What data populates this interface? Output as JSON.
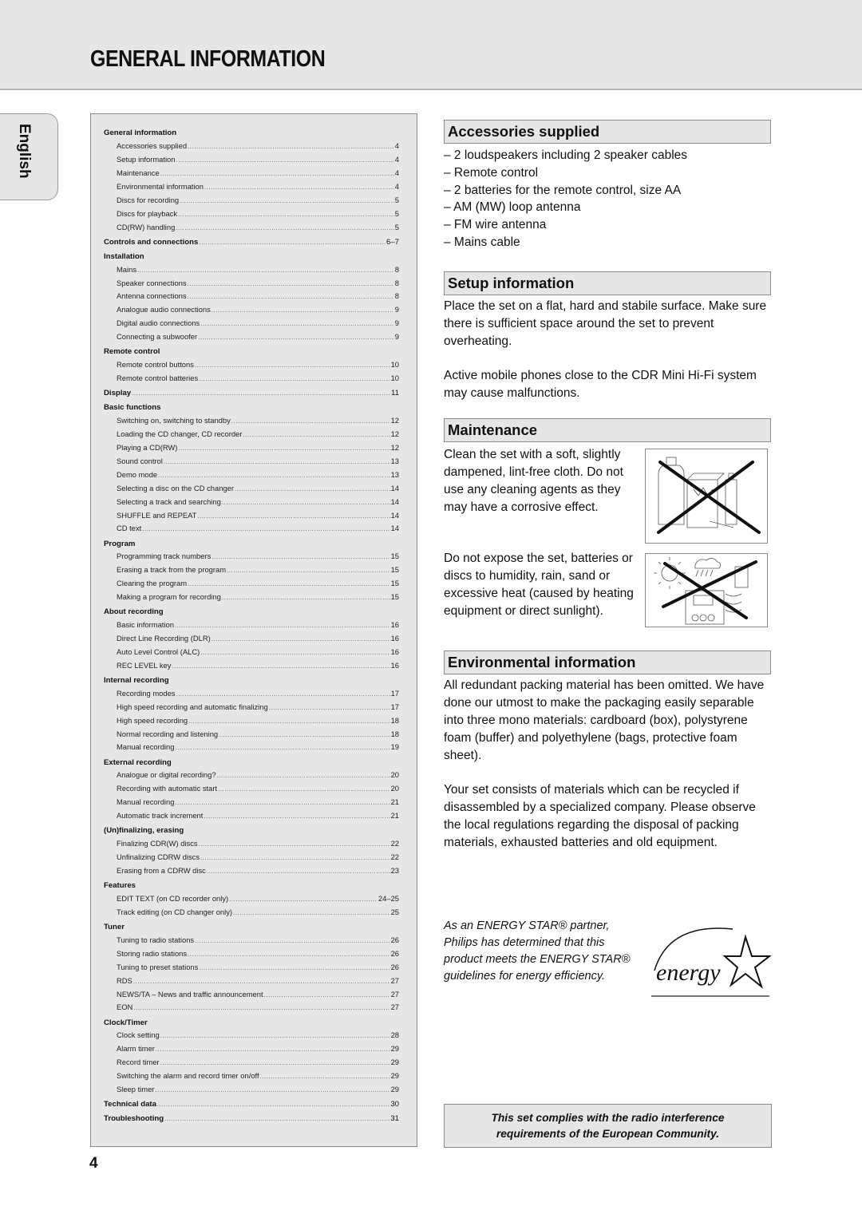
{
  "header": {
    "title": "GENERAL INFORMATION"
  },
  "language_tab": "English",
  "toc": [
    {
      "title": "General information",
      "page": "",
      "items": [
        {
          "label": "Accessories supplied",
          "page": "4"
        },
        {
          "label": "Setup information",
          "page": "4"
        },
        {
          "label": "Maintenance",
          "page": "4"
        },
        {
          "label": "Environmental information",
          "page": "4"
        },
        {
          "label": "Discs for recording",
          "page": "5"
        },
        {
          "label": "Discs for playback",
          "page": "5"
        },
        {
          "label": "CD(RW) handling",
          "page": "5"
        }
      ]
    },
    {
      "title": "Controls and connections",
      "page": "6–7",
      "items": []
    },
    {
      "title": "Installation",
      "page": "",
      "items": [
        {
          "label": "Mains",
          "page": "8"
        },
        {
          "label": "Speaker connections",
          "page": "8"
        },
        {
          "label": "Antenna connections",
          "page": "8"
        },
        {
          "label": "Analogue audio connections",
          "page": "9"
        },
        {
          "label": "Digital audio connections",
          "page": "9"
        },
        {
          "label": "Connecting a subwoofer",
          "page": "9"
        }
      ]
    },
    {
      "title": "Remote control",
      "page": "",
      "items": [
        {
          "label": "Remote control buttons",
          "page": "10"
        },
        {
          "label": "Remote control batteries",
          "page": "10"
        }
      ]
    },
    {
      "title": "Display",
      "page": "11",
      "items": []
    },
    {
      "title": "Basic functions",
      "page": "",
      "items": [
        {
          "label": "Switching on, switching to standby",
          "page": "12"
        },
        {
          "label": "Loading the CD changer, CD recorder",
          "page": "12"
        },
        {
          "label": "Playing a CD(RW)",
          "page": "12"
        },
        {
          "label": "Sound control",
          "page": "13"
        },
        {
          "label": "Demo mode",
          "page": "13"
        },
        {
          "label": "Selecting a disc on the CD changer",
          "page": "14"
        },
        {
          "label": "Selecting a track and searching",
          "page": "14"
        },
        {
          "label": "SHUFFLE and REPEAT",
          "page": "14"
        },
        {
          "label": "CD text",
          "page": "14"
        }
      ]
    },
    {
      "title": "Program",
      "page": "",
      "items": [
        {
          "label": "Programming track numbers",
          "page": "15"
        },
        {
          "label": "Erasing a track from the program",
          "page": "15"
        },
        {
          "label": "Clearing the program",
          "page": "15"
        },
        {
          "label": "Making a program for recording",
          "page": "15"
        }
      ]
    },
    {
      "title": "About recording",
      "page": "",
      "items": [
        {
          "label": "Basic information",
          "page": "16"
        },
        {
          "label": "Direct Line Recording (DLR)",
          "page": "16"
        },
        {
          "label": "Auto Level Control (ALC)",
          "page": "16"
        },
        {
          "label": "REC LEVEL key",
          "page": "16"
        }
      ]
    },
    {
      "title": "Internal recording",
      "page": "",
      "items": [
        {
          "label": "Recording modes",
          "page": "17"
        },
        {
          "label": "High speed recording and automatic finalizing",
          "page": "17"
        },
        {
          "label": "High speed recording",
          "page": "18"
        },
        {
          "label": "Normal recording and listening",
          "page": "18"
        },
        {
          "label": "Manual recording",
          "page": "19"
        }
      ]
    },
    {
      "title": "External recording",
      "page": "",
      "items": [
        {
          "label": "Analogue or digital recording?",
          "page": "20"
        },
        {
          "label": "Recording with automatic start",
          "page": "20"
        },
        {
          "label": "Manual recording",
          "page": "21"
        },
        {
          "label": "Automatic track increment",
          "page": "21"
        }
      ]
    },
    {
      "title": "(Un)finalizing, erasing",
      "page": "",
      "items": [
        {
          "label": "Finalizing CDR(W) discs",
          "page": "22"
        },
        {
          "label": "Unfinalizing CDRW discs",
          "page": "22"
        },
        {
          "label": "Erasing from a CDRW disc",
          "page": "23"
        }
      ]
    },
    {
      "title": "Features",
      "page": "",
      "items": [
        {
          "label": "EDIT TEXT (on CD recorder only)",
          "page": "24–25"
        },
        {
          "label": "Track editing (on CD changer only)",
          "page": "25"
        }
      ]
    },
    {
      "title": "Tuner",
      "page": "",
      "items": [
        {
          "label": "Tuning to radio stations",
          "page": "26"
        },
        {
          "label": "Storing radio stations",
          "page": "26"
        },
        {
          "label": "Tuning to preset stations",
          "page": "26"
        },
        {
          "label": "RDS",
          "page": "27"
        },
        {
          "label": "NEWS/TA – News and traffic announcement",
          "page": "27"
        },
        {
          "label": "EON",
          "page": "27"
        }
      ]
    },
    {
      "title": "Clock/Timer",
      "page": "",
      "items": [
        {
          "label": "Clock setting",
          "page": "28"
        },
        {
          "label": "Alarm timer",
          "page": "29"
        },
        {
          "label": "Record timer",
          "page": "29"
        },
        {
          "label": "Switching the alarm and record timer on/off",
          "page": "29"
        },
        {
          "label": "Sleep timer",
          "page": "29"
        }
      ]
    },
    {
      "title": "Technical data",
      "page": "30",
      "items": []
    },
    {
      "title": "Troubleshooting",
      "page": "31",
      "items": []
    }
  ],
  "accessories": {
    "title": "Accessories supplied",
    "items": [
      "– 2 loudspeakers including 2 speaker cables",
      "– Remote control",
      "– 2 batteries for the remote control, size AA",
      "– AM (MW) loop antenna",
      "– FM wire antenna",
      "– Mains cable"
    ]
  },
  "setup": {
    "title": "Setup information",
    "para1": "Place the set on a flat, hard and stabile surface. Make sure there is sufficient space around the set to prevent overheating.",
    "para2": "Active mobile phones close to the CDR Mini Hi-Fi system may cause malfunctions."
  },
  "maintenance": {
    "title": "Maintenance",
    "para1": "Clean the set with a soft, slightly dampened, lint-free cloth. Do not use any cleaning agents as they may have a corrosive effect.",
    "para2": "Do not expose the set, batteries or discs to humidity, rain, sand or excessive heat (caused by heating equipment or direct sunlight)."
  },
  "environmental": {
    "title": "Environmental information",
    "para1": "All redundant packing material has been omitted. We have done our utmost to make the packaging easily separable into three mono materials: cardboard (box), polystyrene foam (buffer) and polyethylene (bags, protective foam sheet).",
    "para2": "Your set consists of materials which can be recycled if disassembled by a specialized company. Please observe the local regulations regarding the disposal of packing materials, exhausted batteries and old equipment."
  },
  "energy_star": {
    "text": "As an ENERGY STAR® partner, Philips has determined that this product meets the ENERGY STAR® guidelines for energy efficiency.",
    "logo_text": "energy"
  },
  "compliance": {
    "line1": "This set complies with the radio interference",
    "line2": "requirements of the European Community."
  },
  "page_number": "4"
}
